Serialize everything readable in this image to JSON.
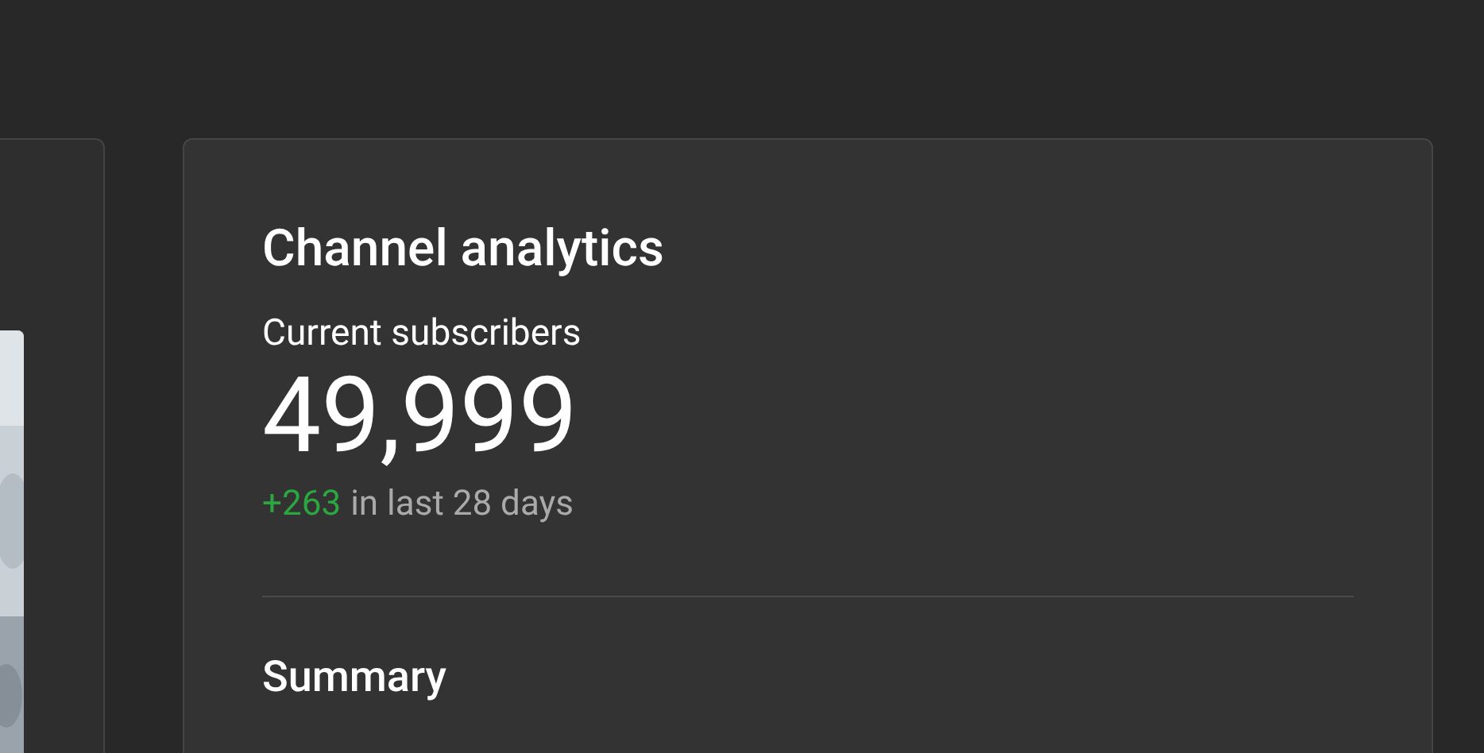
{
  "analytics_card": {
    "title": "Channel analytics",
    "metric_label": "Current subscribers",
    "metric_value": "49,999",
    "change": "+263",
    "change_period": "in last 28 days",
    "section_title": "Summary"
  }
}
